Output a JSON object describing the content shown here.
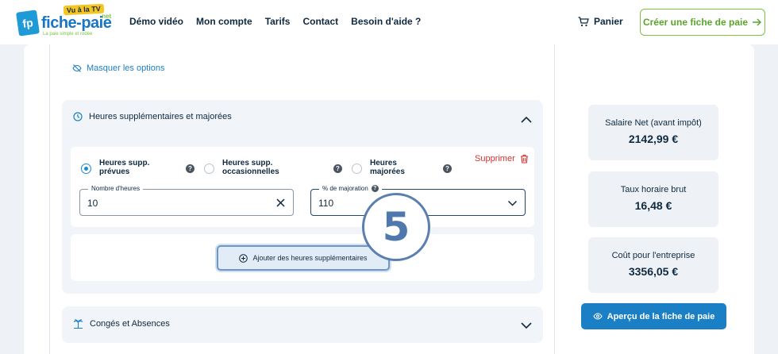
{
  "logo": {
    "mark": "fp",
    "name": "fiche-paie",
    "badge": "Vu à la TV",
    "suffix": ".net",
    "tagline": "La paie simple et rodée"
  },
  "nav": {
    "items": [
      "Démo vidéo",
      "Mon compte",
      "Tarifs",
      "Contact"
    ],
    "help": "Besoin d'aide ?"
  },
  "header": {
    "cart": "Panier",
    "cta": "Créer une fiche de paie"
  },
  "options": {
    "hide_label": "Masquer les options"
  },
  "overtime": {
    "title": "Heures supplémentaires et majorées",
    "types": [
      {
        "line1": "Heures supp.",
        "line2": "prévues",
        "checked": true
      },
      {
        "line1": "Heures supp.",
        "line2": "occasionnelles",
        "checked": false
      },
      {
        "line1": "Heures",
        "line2": "majorées",
        "checked": false
      }
    ],
    "help_glyph": "?",
    "delete": "Supprimer",
    "hours_label": "Nombre d'heures",
    "hours_value": "10",
    "majoration_label": "% de majoration",
    "majoration_value": "110",
    "add_button": "Ajouter des heures supplémentaires"
  },
  "conges": {
    "title": "Congés et Absences"
  },
  "step_marker": "5",
  "summary": [
    {
      "label": "Salaire Net (avant impôt)",
      "value": "2142,99 €"
    },
    {
      "label": "Taux horaire brut",
      "value": "16,48 €"
    },
    {
      "label": "Coût pour l'entreprise",
      "value": "3356,05 €"
    }
  ],
  "preview_button": "Aperçu de la fiche de paie",
  "colors": {
    "primary": "#1a7fc4",
    "accent_green": "#7cc243",
    "danger": "#d62f2f",
    "dark": "#0f2940"
  }
}
